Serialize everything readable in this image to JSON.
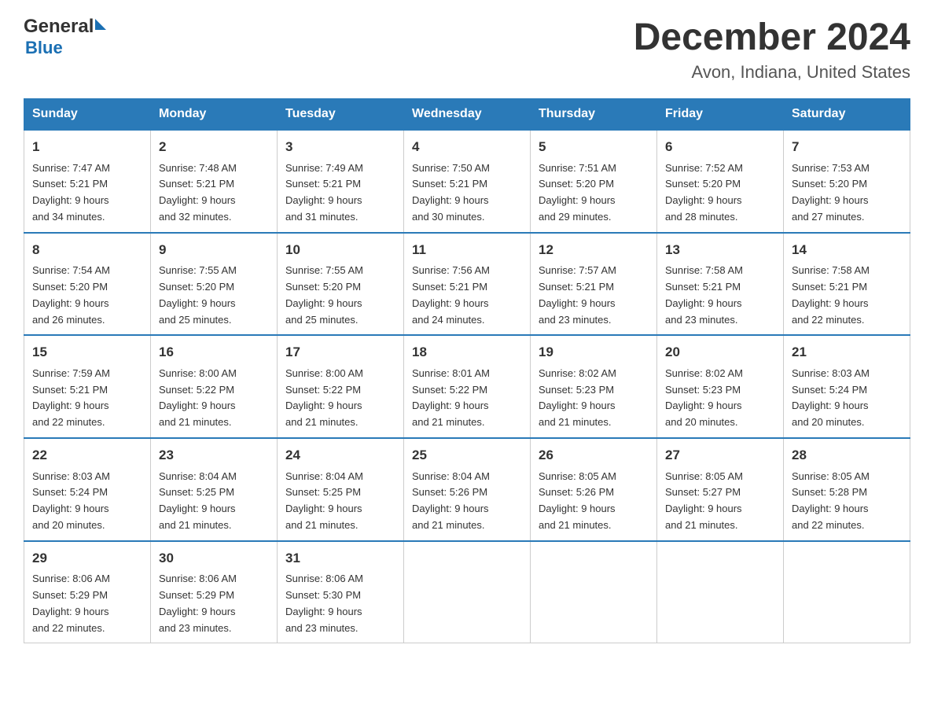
{
  "header": {
    "logo_general": "General",
    "logo_blue": "Blue",
    "title": "December 2024",
    "subtitle": "Avon, Indiana, United States"
  },
  "days_of_week": [
    "Sunday",
    "Monday",
    "Tuesday",
    "Wednesday",
    "Thursday",
    "Friday",
    "Saturday"
  ],
  "weeks": [
    [
      {
        "day": "1",
        "sunrise": "7:47 AM",
        "sunset": "5:21 PM",
        "daylight": "9 hours and 34 minutes."
      },
      {
        "day": "2",
        "sunrise": "7:48 AM",
        "sunset": "5:21 PM",
        "daylight": "9 hours and 32 minutes."
      },
      {
        "day": "3",
        "sunrise": "7:49 AM",
        "sunset": "5:21 PM",
        "daylight": "9 hours and 31 minutes."
      },
      {
        "day": "4",
        "sunrise": "7:50 AM",
        "sunset": "5:21 PM",
        "daylight": "9 hours and 30 minutes."
      },
      {
        "day": "5",
        "sunrise": "7:51 AM",
        "sunset": "5:20 PM",
        "daylight": "9 hours and 29 minutes."
      },
      {
        "day": "6",
        "sunrise": "7:52 AM",
        "sunset": "5:20 PM",
        "daylight": "9 hours and 28 minutes."
      },
      {
        "day": "7",
        "sunrise": "7:53 AM",
        "sunset": "5:20 PM",
        "daylight": "9 hours and 27 minutes."
      }
    ],
    [
      {
        "day": "8",
        "sunrise": "7:54 AM",
        "sunset": "5:20 PM",
        "daylight": "9 hours and 26 minutes."
      },
      {
        "day": "9",
        "sunrise": "7:55 AM",
        "sunset": "5:20 PM",
        "daylight": "9 hours and 25 minutes."
      },
      {
        "day": "10",
        "sunrise": "7:55 AM",
        "sunset": "5:20 PM",
        "daylight": "9 hours and 25 minutes."
      },
      {
        "day": "11",
        "sunrise": "7:56 AM",
        "sunset": "5:21 PM",
        "daylight": "9 hours and 24 minutes."
      },
      {
        "day": "12",
        "sunrise": "7:57 AM",
        "sunset": "5:21 PM",
        "daylight": "9 hours and 23 minutes."
      },
      {
        "day": "13",
        "sunrise": "7:58 AM",
        "sunset": "5:21 PM",
        "daylight": "9 hours and 23 minutes."
      },
      {
        "day": "14",
        "sunrise": "7:58 AM",
        "sunset": "5:21 PM",
        "daylight": "9 hours and 22 minutes."
      }
    ],
    [
      {
        "day": "15",
        "sunrise": "7:59 AM",
        "sunset": "5:21 PM",
        "daylight": "9 hours and 22 minutes."
      },
      {
        "day": "16",
        "sunrise": "8:00 AM",
        "sunset": "5:22 PM",
        "daylight": "9 hours and 21 minutes."
      },
      {
        "day": "17",
        "sunrise": "8:00 AM",
        "sunset": "5:22 PM",
        "daylight": "9 hours and 21 minutes."
      },
      {
        "day": "18",
        "sunrise": "8:01 AM",
        "sunset": "5:22 PM",
        "daylight": "9 hours and 21 minutes."
      },
      {
        "day": "19",
        "sunrise": "8:02 AM",
        "sunset": "5:23 PM",
        "daylight": "9 hours and 21 minutes."
      },
      {
        "day": "20",
        "sunrise": "8:02 AM",
        "sunset": "5:23 PM",
        "daylight": "9 hours and 20 minutes."
      },
      {
        "day": "21",
        "sunrise": "8:03 AM",
        "sunset": "5:24 PM",
        "daylight": "9 hours and 20 minutes."
      }
    ],
    [
      {
        "day": "22",
        "sunrise": "8:03 AM",
        "sunset": "5:24 PM",
        "daylight": "9 hours and 20 minutes."
      },
      {
        "day": "23",
        "sunrise": "8:04 AM",
        "sunset": "5:25 PM",
        "daylight": "9 hours and 21 minutes."
      },
      {
        "day": "24",
        "sunrise": "8:04 AM",
        "sunset": "5:25 PM",
        "daylight": "9 hours and 21 minutes."
      },
      {
        "day": "25",
        "sunrise": "8:04 AM",
        "sunset": "5:26 PM",
        "daylight": "9 hours and 21 minutes."
      },
      {
        "day": "26",
        "sunrise": "8:05 AM",
        "sunset": "5:26 PM",
        "daylight": "9 hours and 21 minutes."
      },
      {
        "day": "27",
        "sunrise": "8:05 AM",
        "sunset": "5:27 PM",
        "daylight": "9 hours and 21 minutes."
      },
      {
        "day": "28",
        "sunrise": "8:05 AM",
        "sunset": "5:28 PM",
        "daylight": "9 hours and 22 minutes."
      }
    ],
    [
      {
        "day": "29",
        "sunrise": "8:06 AM",
        "sunset": "5:29 PM",
        "daylight": "9 hours and 22 minutes."
      },
      {
        "day": "30",
        "sunrise": "8:06 AM",
        "sunset": "5:29 PM",
        "daylight": "9 hours and 23 minutes."
      },
      {
        "day": "31",
        "sunrise": "8:06 AM",
        "sunset": "5:30 PM",
        "daylight": "9 hours and 23 minutes."
      },
      null,
      null,
      null,
      null
    ]
  ],
  "labels": {
    "sunrise": "Sunrise:",
    "sunset": "Sunset:",
    "daylight": "Daylight:"
  }
}
